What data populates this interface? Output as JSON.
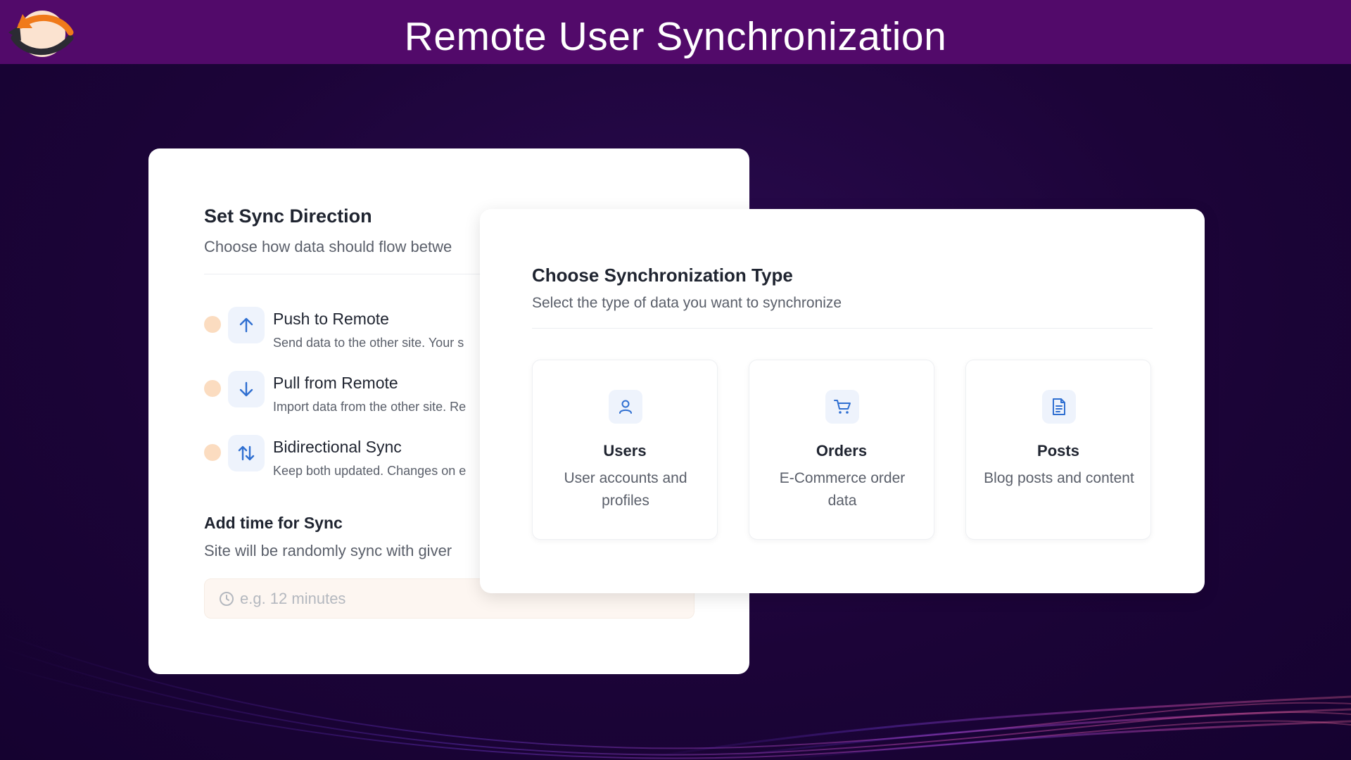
{
  "banner": {
    "title": "Remote User Synchronization",
    "logo_icon": "sync-arrows-logo"
  },
  "sync_direction": {
    "title": "Set Sync Direction",
    "subtitle": "Choose how data should flow betwe",
    "options": [
      {
        "label": "Push to Remote",
        "description": "Send data to the other site. Your s",
        "icon": "arrow-up-icon"
      },
      {
        "label": "Pull from Remote",
        "description": "Import data from the other site. Re",
        "icon": "arrow-down-icon"
      },
      {
        "label": "Bidirectional Sync",
        "description": "Keep both updated. Changes on e",
        "icon": "arrows-up-down-icon"
      }
    ],
    "time": {
      "title": "Add time for Sync",
      "subtitle": "Site will be randomly sync with giver",
      "placeholder": "e.g. 12 minutes",
      "icon": "clock-icon"
    }
  },
  "sync_type": {
    "title": "Choose Synchronization Type",
    "subtitle": "Select the type of data you want to synchronize",
    "types": [
      {
        "name": "Users",
        "description": "User accounts and profiles",
        "icon": "user-icon"
      },
      {
        "name": "Orders",
        "description": "E-Commerce order data",
        "icon": "cart-icon"
      },
      {
        "name": "Posts",
        "description": "Blog posts and content",
        "icon": "document-icon"
      }
    ]
  },
  "colors": {
    "banner": "#520a6a",
    "background": "#1c0438",
    "accent_blue": "#2f6fd1",
    "radio": "#fbdcc0"
  }
}
